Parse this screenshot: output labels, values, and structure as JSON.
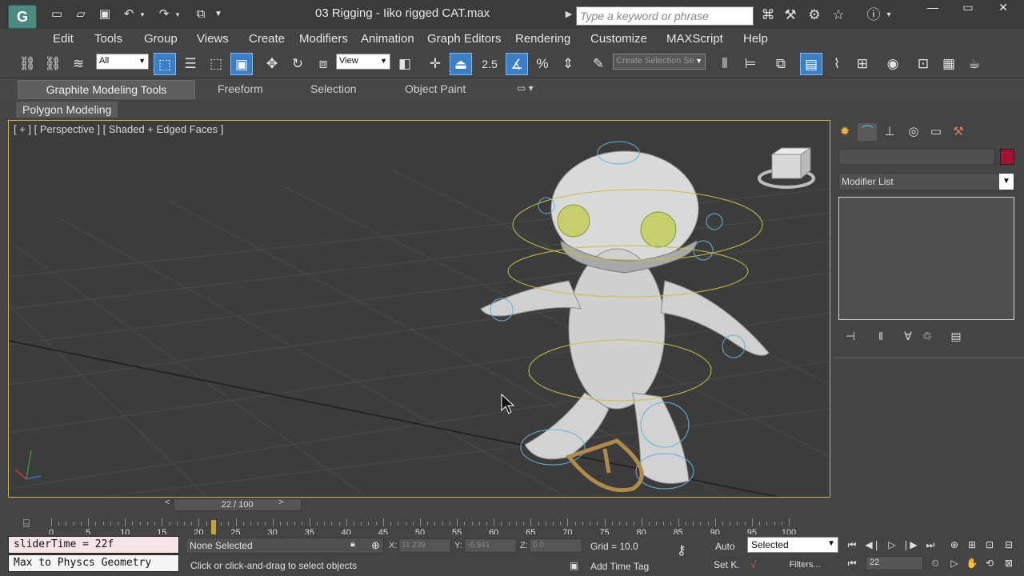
{
  "titlebar": {
    "title": "03 Rigging - Iiko rigged CAT.max",
    "search_placeholder": "Type a keyword or phrase",
    "logo_glyph": "G"
  },
  "menu": {
    "items": [
      "Edit",
      "Tools",
      "Group",
      "Views",
      "Create",
      "Modifiers",
      "Animation",
      "Graph Editors",
      "Rendering",
      "Customize",
      "MAXScript",
      "Help"
    ]
  },
  "toolbar": {
    "selection_filter": "All",
    "reference_coord": "View",
    "snap_value": "2.5",
    "named_selection": "Create Selection Se"
  },
  "ribbon": {
    "tabs": [
      "Graphite Modeling Tools",
      "Freeform",
      "Selection",
      "Object Paint"
    ],
    "sub_tab": "Polygon Modeling"
  },
  "viewport": {
    "label": "[ + ] [ Perspective ] [ Shaded + Edged Faces ]"
  },
  "command_panel": {
    "modifier_list_label": "Modifier List",
    "swatch_color": "#a0122f"
  },
  "timeline": {
    "slider_label": "22 / 100",
    "current_frame": 22,
    "start": 0,
    "end": 100,
    "tick_labels": [
      "0",
      "5",
      "10",
      "15",
      "20",
      "25",
      "30",
      "35",
      "40",
      "45",
      "50",
      "55",
      "60",
      "65",
      "70",
      "75",
      "80",
      "85",
      "90",
      "95",
      "100"
    ]
  },
  "status": {
    "listener_top": "sliderTime = 22f",
    "listener_bottom": "Max to Physcs Geometry",
    "selection": "None Selected",
    "prompt": "Click or click-and-drag to select objects",
    "x_label": "X:",
    "x_value": "11.239",
    "y_label": "Y:",
    "y_value": "-6.941",
    "z_label": "Z:",
    "z_value": "0.0",
    "grid": "Grid = 10.0",
    "add_time_tag": "Add Time Tag",
    "auto_key": "Auto",
    "key_mode": "Selected",
    "set_key": "Set K.",
    "filters": "Filters...",
    "frame_value": "22"
  }
}
